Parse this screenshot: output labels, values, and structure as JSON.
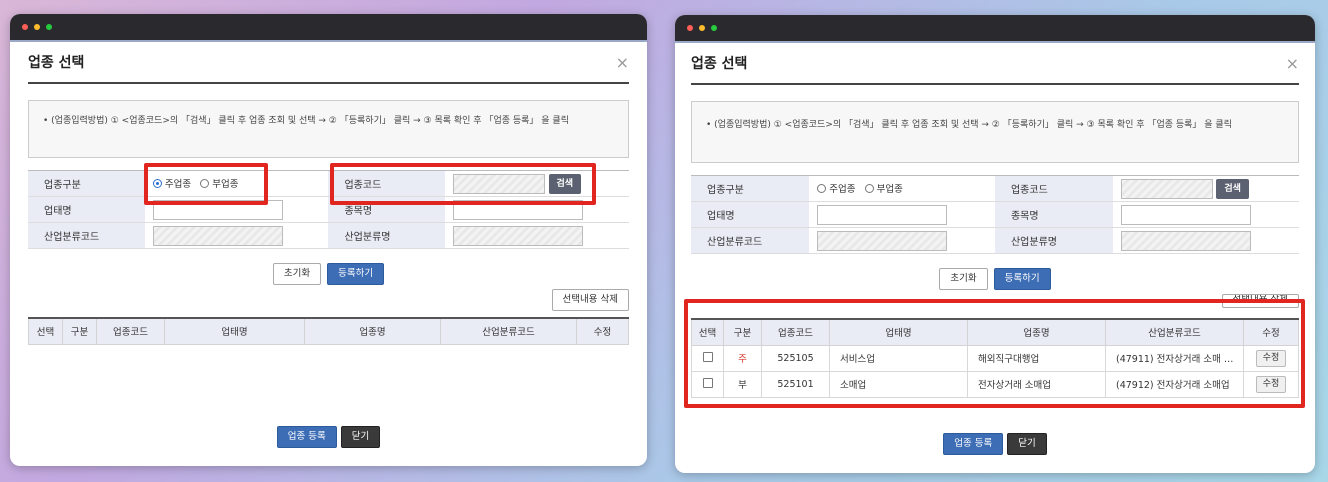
{
  "left": {
    "title": "업종 선택",
    "close": "×",
    "guide": "• (업종입력방법) ① <업종코드>의 「검색」 클릭 후 업종 조회 및 선택 → ② 「등록하기」 클릭 → ③ 목록 확인 후 「업종 등록」 을 클릭",
    "labels": {
      "type": "업종구분",
      "code": "업종코드",
      "biz": "업태명",
      "item": "종목명",
      "ind_code": "산업분류코드",
      "ind_name": "산업분류명"
    },
    "radio_main": "주업종",
    "radio_sub": "부업종",
    "search": "검색",
    "reset": "초기화",
    "register": "등록하기",
    "delete_sel": "선택내용 삭제",
    "columns": [
      "선택",
      "구분",
      "업종코드",
      "업태명",
      "업종명",
      "산업분류코드",
      "수정"
    ],
    "submit": "업종 등록",
    "close_btn": "닫기"
  },
  "right": {
    "title": "업종 선택",
    "close": "×",
    "guide": "• (업종입력방법) ① <업종코드>의 「검색」 클릭 후 업종 조회 및 선택 → ② 「등록하기」 클릭 → ③ 목록 확인 후 「업종 등록」 을 클릭",
    "labels": {
      "type": "업종구분",
      "code": "업종코드",
      "biz": "업태명",
      "item": "종목명",
      "ind_code": "산업분류코드",
      "ind_name": "산업분류명"
    },
    "radio_main": "주업종",
    "radio_sub": "부업종",
    "search": "검색",
    "reset": "초기화",
    "register": "등록하기",
    "delete_sel": "선택내용 삭제",
    "columns": [
      "선택",
      "구분",
      "업종코드",
      "업태명",
      "업종명",
      "산업분류코드",
      "수정"
    ],
    "rows": [
      {
        "kind": "주",
        "code": "525105",
        "biz": "서비스업",
        "name": "해외직구대행업",
        "ind": "(47911) 전자상거래 소매 …",
        "edit": "수정"
      },
      {
        "kind": "부",
        "code": "525101",
        "biz": "소매업",
        "name": "전자상거래 소매업",
        "ind": "(47912) 전자상거래 소매업",
        "edit": "수정"
      }
    ],
    "submit": "업종 등록",
    "close_btn": "닫기"
  }
}
